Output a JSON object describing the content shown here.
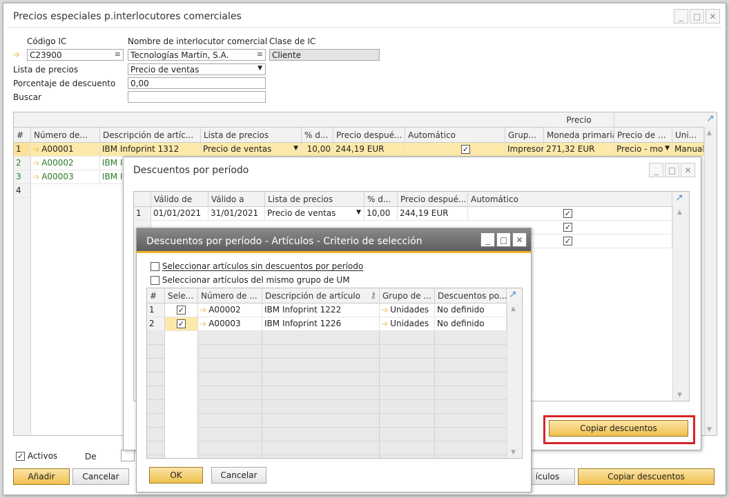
{
  "main": {
    "title": "Precios especiales p.interlocutores comerciales",
    "labels": {
      "codigo": "Código IC",
      "nombre": "Nombre de interlocutor comercial",
      "clase": "Clase de IC",
      "lista": "Lista de precios",
      "porcentaje": "Porcentaje de descuento",
      "buscar": "Buscar"
    },
    "values": {
      "codigo": "C23900",
      "nombre": "Tecnologías Martín, S.A.",
      "clase": "Cliente",
      "lista": "Precio de ventas",
      "porcentaje": "0,00",
      "buscar": ""
    },
    "grid": {
      "group_header": "Precio",
      "headers": [
        "#",
        "Número de...",
        "Descripción de artíc...",
        "Lista de precios",
        "% d...",
        "Precio despué...",
        "Automático",
        "Grup...",
        "Moneda primaria",
        "Precio de ...",
        "Uni..."
      ],
      "rows": [
        {
          "n": "1",
          "num": "A00001",
          "desc": "IBM Infoprint 1312",
          "lista": "Precio de ventas",
          "pct": "10,00",
          "precio": "244,19 EUR",
          "auto": "✓",
          "grupo": "Impresor",
          "moneda": "271,32 EUR",
          "precio_de": "Precio - mo",
          "uni": "Manual"
        },
        {
          "n": "2",
          "num": "A00002",
          "desc": "IBM I"
        },
        {
          "n": "3",
          "num": "A00003",
          "desc": "IBM I"
        },
        {
          "n": "4"
        }
      ]
    },
    "activos": "Activos",
    "de": "De",
    "btn_anadir": "Añadir",
    "btn_cancelar": "Cancelar",
    "btn_articulos": "ículos",
    "btn_copiar": "Copiar descuentos"
  },
  "periodo": {
    "title": "Descuentos por período",
    "headers": [
      "Válido de",
      "Válido a",
      "Lista de precios",
      "% d...",
      "Precio despué...",
      "Automático"
    ],
    "rows": [
      {
        "n": "1",
        "de": "01/01/2021",
        "a": "31/01/2021",
        "lista": "Precio de ventas",
        "pct": "10,00",
        "precio": "244,19 EUR",
        "auto": "✓"
      }
    ],
    "btn_copiar": "Copiar descuentos"
  },
  "criterio": {
    "title": "Descuentos por período - Artículos - Criterio de selección",
    "chk1": "Seleccionar artículos sin descuentos por período",
    "chk2": "Seleccionar artículos del mismo grupo de UM",
    "headers": [
      "#",
      "Sele...",
      "Número de ...",
      "Descripción de artículo",
      "Grupo de ...",
      "Descuentos po..."
    ],
    "rows": [
      {
        "n": "1",
        "num": "A00002",
        "desc": "IBM Infoprint 1222",
        "grupo": "Unidades",
        "desc_por": "No definido"
      },
      {
        "n": "2",
        "num": "A00003",
        "desc": "IBM Infoprint 1226",
        "grupo": "Unidades",
        "desc_por": "No definido"
      }
    ],
    "btn_ok": "OK",
    "btn_cancelar": "Cancelar"
  },
  "colors": {
    "accent": "#f0c04d",
    "highlight": "#d8232a",
    "row_selected": "#fde9a9"
  }
}
